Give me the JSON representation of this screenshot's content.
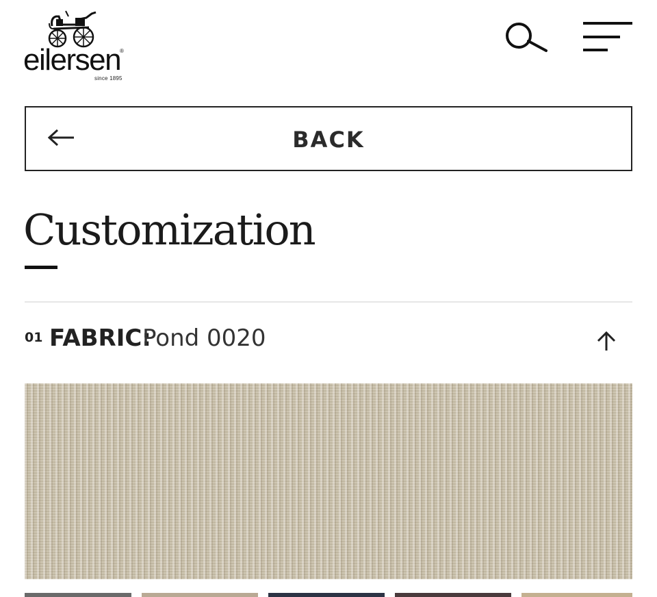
{
  "header": {
    "logo_text": "eilersen",
    "logo_since": "since 1895",
    "logo_reg": "®",
    "search_icon": "search-icon",
    "menu_icon": "hamburger-menu-icon"
  },
  "back_button": {
    "label": "BACK",
    "icon": "arrow-left-icon"
  },
  "page": {
    "title": "Customization"
  },
  "section": {
    "number": "01",
    "label": "FABRIC:",
    "value": "Pond 0020",
    "icon": "arrow-up-icon"
  },
  "fabric": {
    "selected_color": "#c9bfa9",
    "thumbnails": [
      {
        "color": "#6a6a6a"
      },
      {
        "color": "#b9a994"
      },
      {
        "color": "#2c3344"
      },
      {
        "color": "#4a3a3c"
      },
      {
        "color": "#c4b090"
      }
    ]
  }
}
